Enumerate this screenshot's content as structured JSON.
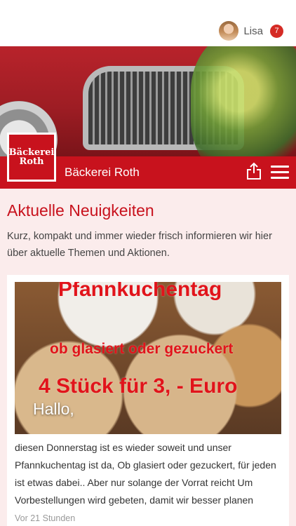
{
  "header": {
    "user_name": "Lisa",
    "notification_count": "7"
  },
  "brand": {
    "logo_line1": "Bäckerei",
    "logo_line2": "Roth",
    "name": "Bäckerei Roth"
  },
  "section": {
    "title": "Aktuelle Neuigkeiten",
    "intro": "Kurz, kompakt und immer wieder frisch informieren wir hier über aktuelle Themen und Aktionen."
  },
  "post": {
    "image_text_line1": "Pfannkuchentag",
    "image_text_line2": "ob glasiert oder gezuckert",
    "image_text_line3": "4 Stück für 3, - Euro",
    "greeting": "Hallo,",
    "body": "diesen Donnerstag ist es wieder soweit und unser Pfannkuchentag ist da, Ob glasiert oder gezuckert, für jeden ist etwas dabei.. Aber nur solange der Vorrat reicht Um Vorbestellungen wird gebeten, damit wir besser planen",
    "timestamp": "Vor 21 Stunden"
  },
  "colors": {
    "brand_red": "#c8121d",
    "badge_red": "#d52b25",
    "page_bg": "#fbecec"
  },
  "icons": {
    "share": "share-icon",
    "menu": "hamburger-menu-icon"
  }
}
